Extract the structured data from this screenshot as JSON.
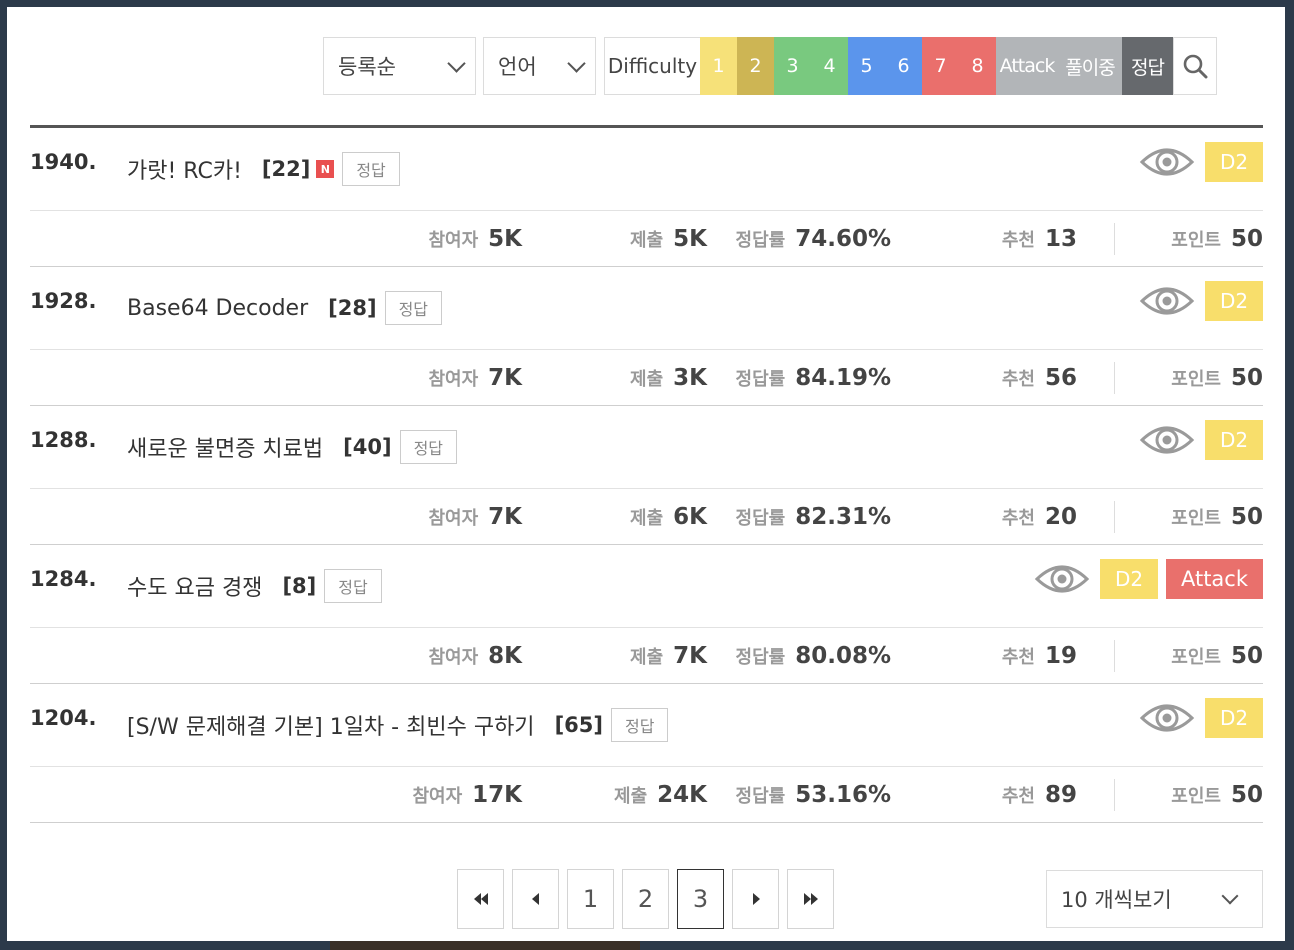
{
  "filters": {
    "order_select": "등록순",
    "language_select": "언어",
    "difficulty_label": "Difficulty",
    "levels": [
      {
        "label": "1",
        "color": "#f6e179"
      },
      {
        "label": "2",
        "color": "#cdb554"
      },
      {
        "label": "3",
        "color": "#79c97f"
      },
      {
        "label": "4",
        "color": "#79c97f"
      },
      {
        "label": "5",
        "color": "#5b95ec"
      },
      {
        "label": "6",
        "color": "#5b95ec"
      },
      {
        "label": "7",
        "color": "#ea6f6c"
      },
      {
        "label": "8",
        "color": "#ea6f6c"
      }
    ],
    "attack_label": "Attack",
    "solving_label": "풀이중",
    "solved_label": "정답",
    "search_icon": "search-icon"
  },
  "stat_labels": {
    "participants": "참여자",
    "submissions": "제출",
    "accuracy": "정답률",
    "recommend": "추천",
    "points": "포인트"
  },
  "problems": [
    {
      "number": "1940.",
      "title": "가랏! RC카!",
      "count": "[22]",
      "new_badge": "N",
      "status": "정답",
      "difficulty": "D2",
      "tag": "",
      "participants": "5K",
      "submissions": "5K",
      "accuracy": "74.60%",
      "recommend": "13",
      "points": "50"
    },
    {
      "number": "1928.",
      "title": "Base64 Decoder",
      "count": "[28]",
      "new_badge": "",
      "status": "정답",
      "difficulty": "D2",
      "tag": "",
      "participants": "7K",
      "submissions": "3K",
      "accuracy": "84.19%",
      "recommend": "56",
      "points": "50"
    },
    {
      "number": "1288.",
      "title": "새로운 불면증 치료법",
      "count": "[40]",
      "new_badge": "",
      "status": "정답",
      "difficulty": "D2",
      "tag": "",
      "participants": "7K",
      "submissions": "6K",
      "accuracy": "82.31%",
      "recommend": "20",
      "points": "50"
    },
    {
      "number": "1284.",
      "title": "수도 요금 경쟁",
      "count": "[8]",
      "new_badge": "",
      "status": "정답",
      "difficulty": "D2",
      "tag": "Attack",
      "participants": "8K",
      "submissions": "7K",
      "accuracy": "80.08%",
      "recommend": "19",
      "points": "50"
    },
    {
      "number": "1204.",
      "title": "[S/W 문제해결 기본] 1일차 - 최빈수 구하기",
      "count": "[65]",
      "new_badge": "",
      "status": "정답",
      "difficulty": "D2",
      "tag": "",
      "participants": "17K",
      "submissions": "24K",
      "accuracy": "53.16%",
      "recommend": "89",
      "points": "50"
    }
  ],
  "pagination": {
    "pages": [
      "1",
      "2",
      "3"
    ],
    "current": "3"
  },
  "per_page_select": "10 개씩보기",
  "colors": {
    "difficulty_badge": "#f8de6b",
    "attack_tag": "#e9706c",
    "grey_filter": "#b2b5b8",
    "dark_filter": "#66696d"
  }
}
